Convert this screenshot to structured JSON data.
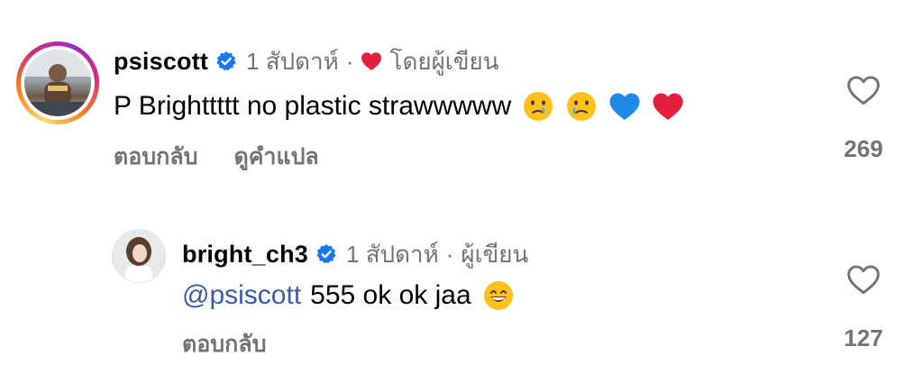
{
  "comments": [
    {
      "username": "psiscott",
      "time": "1 สัปดาห์",
      "separator": "·",
      "author_label": "โดยผู้เขียน",
      "text": "P Brighttttt no plastic strawwwww",
      "emojis": [
        "crying-face",
        "crying-face",
        "blue-heart",
        "red-heart"
      ],
      "actions": [
        "ตอบกลับ",
        "ดูคำแปล"
      ],
      "like_count": "269"
    },
    {
      "username": "bright_ch3",
      "time": "1 สัปดาห์",
      "separator": "·",
      "author_label": "ผู้เขียน",
      "mention": "@psiscott",
      "text": "555 ok ok jaa",
      "emojis": [
        "grinning-face"
      ],
      "actions": [
        "ตอบกลับ"
      ],
      "like_count": "127"
    }
  ],
  "colors": {
    "secondary_text": "#737373",
    "mention": "#3d5aa8",
    "verified": "#1877f2",
    "heart": "#e41e3f"
  }
}
